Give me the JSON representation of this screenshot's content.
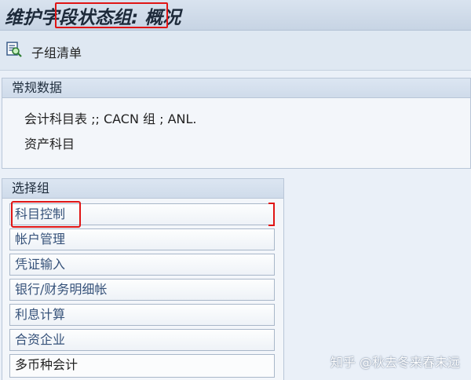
{
  "title": {
    "text": "维护字段状态组: 概况"
  },
  "toolbar": {
    "subgroup_list_label": "子组清单",
    "subgroup_list_icon": "list-magnifier-icon"
  },
  "general_data": {
    "header": "常规数据",
    "row1": "会计科目表 ;; CACN     组 ; ANL.",
    "row2": "资产科目"
  },
  "select_group": {
    "header": "选择组",
    "items": [
      {
        "label": "科目控制"
      },
      {
        "label": "帐户管理"
      },
      {
        "label": "凭证输入"
      },
      {
        "label": "银行/财务明细帐"
      },
      {
        "label": "利息计算"
      },
      {
        "label": "合资企业"
      },
      {
        "label": "多币种会计"
      }
    ]
  },
  "watermark": "知乎 @秋去冬来春未远",
  "colors": {
    "highlight": "#e01515",
    "link_text": "#36527a",
    "title_bar": "#c7d4e4"
  }
}
